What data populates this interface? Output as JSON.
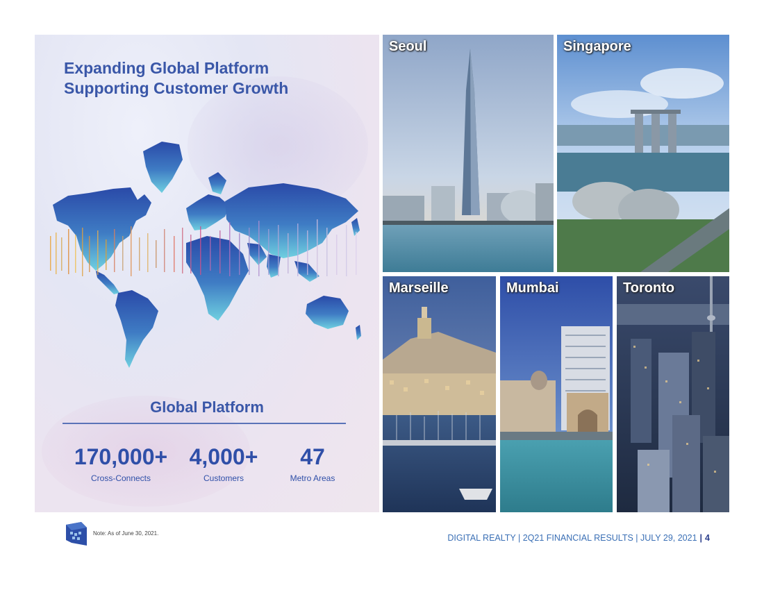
{
  "headline": {
    "line1": "Expanding Global Platform",
    "line2": "Supporting Customer Growth"
  },
  "global_platform": {
    "title": "Global Platform",
    "stats": [
      {
        "value": "170,000+",
        "label": "Cross-Connects"
      },
      {
        "value": "4,000+",
        "label": "Customers"
      },
      {
        "value": "47",
        "label": "Metro Areas"
      }
    ]
  },
  "cities": {
    "seoul": "Seoul",
    "singapore": "Singapore",
    "marseille": "Marseille",
    "mumbai": "Mumbai",
    "toronto": "Toronto"
  },
  "footer": {
    "note": "Note: As of June 30, 2021.",
    "text": "DIGITAL REALTY | 2Q21 FINANCIAL RESULTS | JULY 29, 2021",
    "separator": "|",
    "page": "4"
  },
  "colors": {
    "brand_blue": "#3a57a8",
    "footer_blue": "#3a6fb5"
  }
}
